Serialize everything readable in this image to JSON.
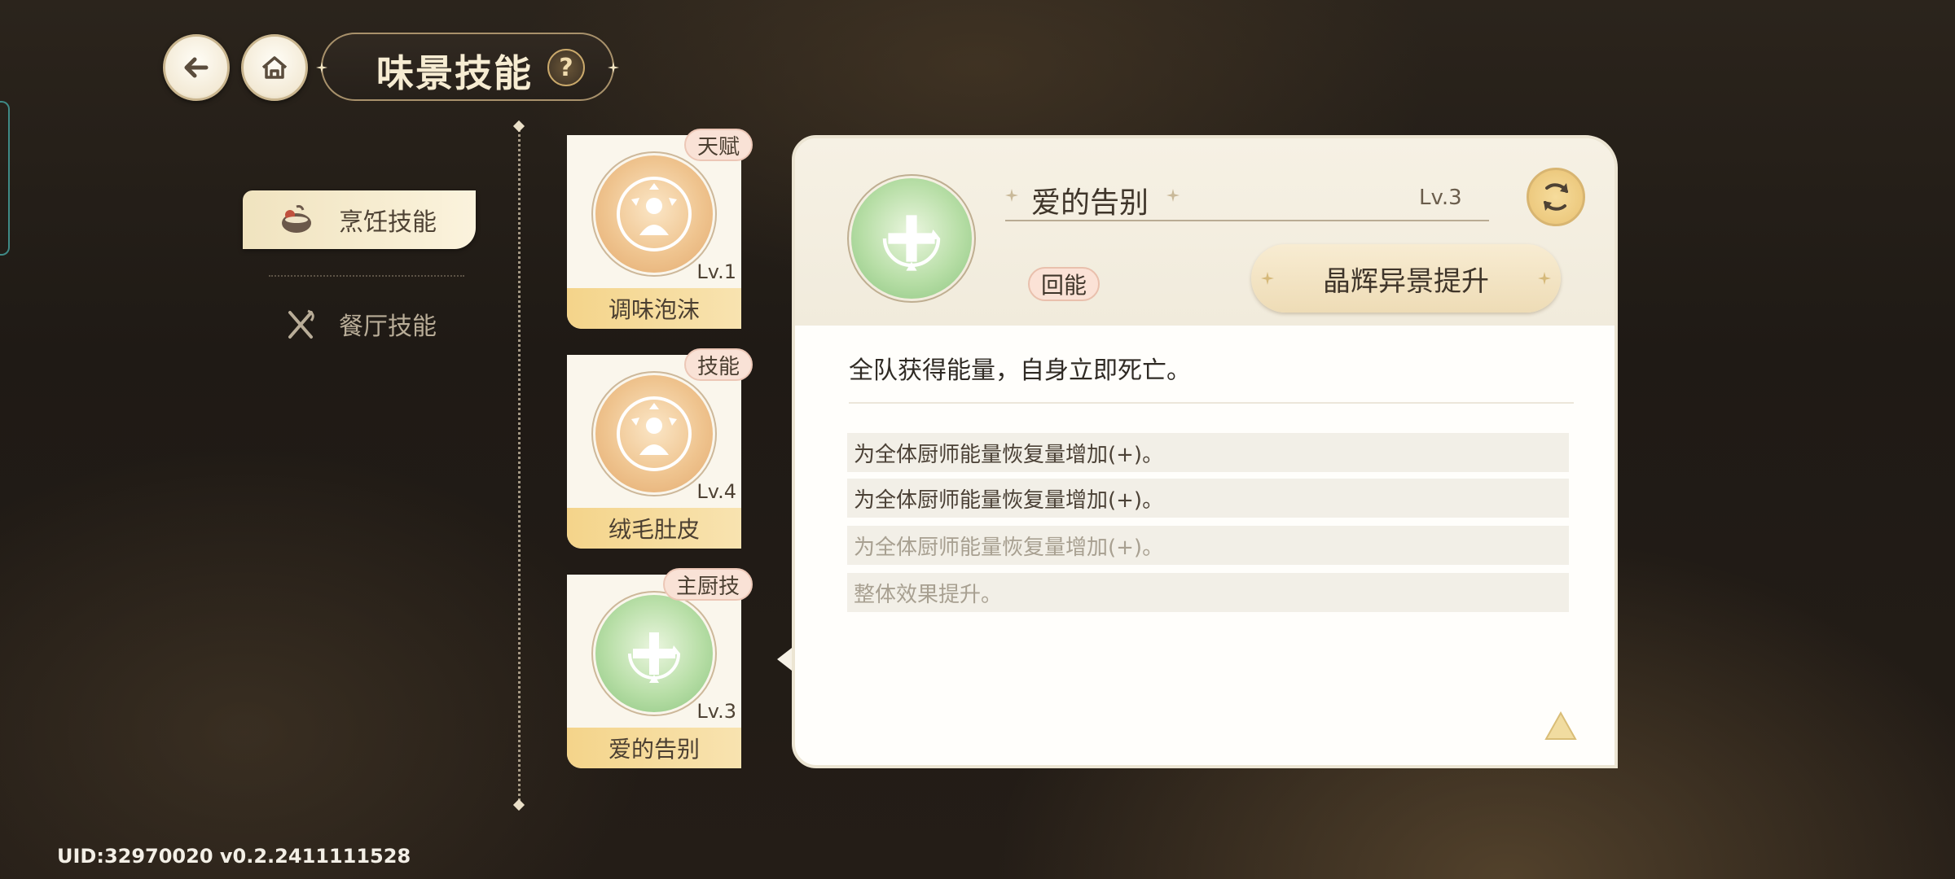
{
  "header": {
    "back_icon": "back-arrow-icon",
    "home_icon": "home-icon",
    "title": "味景技能",
    "help_label": "?"
  },
  "tabs": [
    {
      "label": "烹饪技能",
      "icon": "cooking-pot-icon",
      "active": true
    },
    {
      "label": "餐厅技能",
      "icon": "fork-knife-icon",
      "active": false
    }
  ],
  "skills": [
    {
      "tag": "天赋",
      "level": "Lv.1",
      "name": "调味泡沫",
      "color": "orange"
    },
    {
      "tag": "技能",
      "level": "Lv.4",
      "name": "绒毛肚皮",
      "color": "orange"
    },
    {
      "tag": "主厨技",
      "level": "Lv.3",
      "name": "爱的告别",
      "color": "green"
    }
  ],
  "detail": {
    "name": "爱的告别",
    "level": "Lv.3",
    "type_badge": "回能",
    "upgrade_label": "晶辉异景提升",
    "description": "全队获得能量，自身立即死亡。",
    "effects": [
      {
        "text": "为全体厨师能量恢复量增加(+)。",
        "active": true
      },
      {
        "text": "为全体厨师能量恢复量增加(+)。",
        "active": true
      },
      {
        "text": "为全体厨师能量恢复量增加(+)。",
        "active": false
      },
      {
        "text": "整体效果提升。",
        "active": false
      }
    ]
  },
  "footer": {
    "uid": "UID:32970020 v0.2.2411111528"
  },
  "colors": {
    "accent_gold": "#f4d48a",
    "panel_bg": "#fffefb",
    "badge_pink": "#f9e2d6",
    "skill_green": "#b7dea6",
    "skill_orange": "#efc48f"
  }
}
